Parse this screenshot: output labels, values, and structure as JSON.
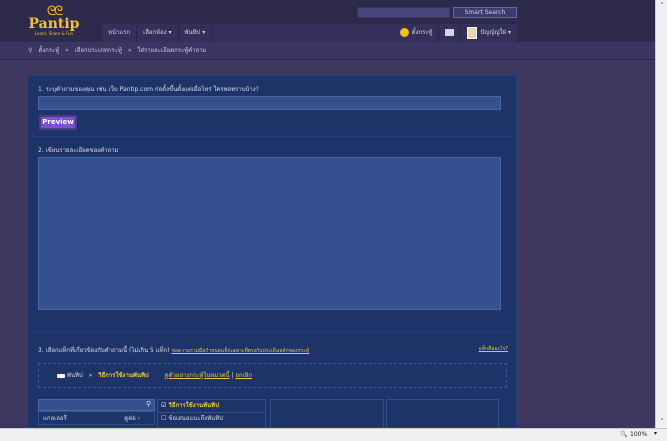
{
  "logo": {
    "mark": "ᘓᘓ",
    "name": "Pantip",
    "tagline": "Learn, Share & Fun"
  },
  "search": {
    "button": "Smart Search",
    "value": ""
  },
  "nav": {
    "home": "หน้าแรก",
    "rooms": "เลือกห้อง ▾",
    "pantip": "พันทิป ▾",
    "post": "ตั้งกระทู้",
    "user": "ปัญญ์ญ่ใฝ่ ▾"
  },
  "breadcrumb": [
    "ตั้งกระทู้",
    "»",
    "เลือกประเภทกระทู้",
    "»",
    "ใส่รายละเอียดกระทู้คำถาม"
  ],
  "form": {
    "q1": "1. ระบุคำถามของคุณ เช่น เว็บ Pantip.com ก่อตั้งขึ้นตั้งแต่เมื่อไหร่ ใครพอทราบบ้าง?",
    "title_value": "",
    "preview": "Preview",
    "q2": "2. เขียนรายละเอียดของคำถาม",
    "detail_value": "",
    "q3": "3. เลือกแท็กที่เกี่ยวข้องกับคำถามนี้ (ไม่เกิน 5 แท็ก)",
    "q3_link": "ขอความร่วมมือกำหนดแท็กเฉพาะที่ตรงกับประเด็นหลักของกระทู้",
    "what_tag": "แท็กคืออะไร?",
    "tag_path": "พันทิป",
    "tag_sep": "»",
    "tag_current": "วิธีการใช้งานพันทิป",
    "tag_example": "ดูตัวอย่างกระทู้ในหมวดนี้",
    "tag_cancel": "ยกเลิก",
    "list_item": "แกลเลอรี่",
    "list_more": "ดูต่อ ›",
    "checks": [
      {
        "label": "วิธีการใช้งานพันทิป",
        "checked": true
      },
      {
        "label": "ข้อเสนอแนะถึงพันทิป",
        "checked": false
      }
    ]
  },
  "status": {
    "zoom": "100%"
  }
}
